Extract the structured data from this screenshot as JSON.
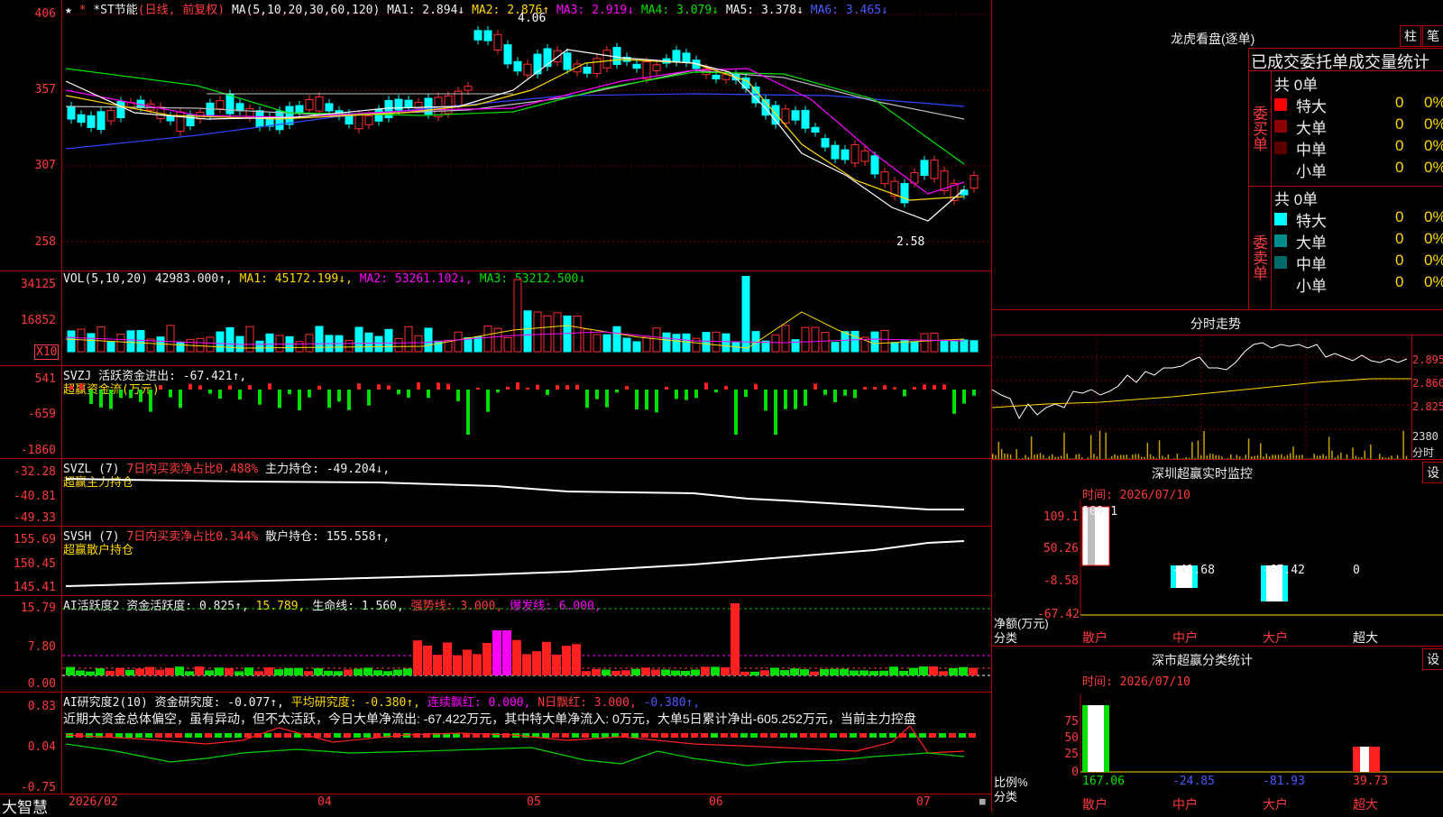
{
  "header": {
    "star_icon": "★",
    "stock_name": "*ST节能",
    "chart_mode": "(日线, 前复权)",
    "ma_label": "MA(5,10,20,30,60,120)",
    "ma1": "MA1: 2.894↓",
    "ma2": "MA2: 2.876↑",
    "ma3": "MA3: 2.919↓",
    "ma4": "MA4: 3.079↓",
    "ma5": "MA5: 3.378↓",
    "ma6": "MA6: 3.465↓"
  },
  "price_axis": [
    "406",
    "357",
    "307",
    "258"
  ],
  "price_annotations": {
    "high": "4.06",
    "low": "2.58"
  },
  "volume": {
    "label": "VOL(5,10,20)",
    "value": "42983.000↑,",
    "ma1": "MA1: 45172.199↓,",
    "ma2": "MA2: 53261.102↓,",
    "ma3": "MA3: 53212.500↓",
    "axis": [
      "34125",
      "16852"
    ],
    "unit": "X10"
  },
  "svzj": {
    "label": "SVZJ",
    "value": "活跃资金进出: -67.421↑,",
    "subtitle": "超赢资金流(万元)",
    "axis": [
      "541",
      "-659",
      "-1860"
    ]
  },
  "svzl": {
    "label": "SVZL (7)",
    "ratio": "7日内买卖净占比0.488%",
    "value": "主力持仓: -49.204↓,",
    "subtitle": "超赢主力持仓",
    "axis": [
      "-32.28",
      "-40.81",
      "-49.33"
    ]
  },
  "svsh": {
    "label": "SVSH (7)",
    "ratio": "7日内买卖净占比0.344%",
    "value": "散户持仓: 155.558↑,",
    "subtitle": "超赢散户持仓",
    "axis": [
      "155.69",
      "150.45",
      "145.41"
    ]
  },
  "ai_active": {
    "label": "AI活跃度2",
    "value": "资金活跃度: 0.825↑,",
    "v2": "15.789,",
    "life": "生命线: 1.560,",
    "strong": "强势线: 3.000,",
    "burst": "爆发线: 6.000,",
    "axis": [
      "15.79",
      "7.80",
      "0.00"
    ]
  },
  "ai_research": {
    "label": "AI研究度2(10)",
    "value": "资金研究度: -0.077↑,",
    "avg": "平均研究度: -0.380↑,",
    "cont": "连续飘红: 0.000,",
    "nday": "N日飘红: 3.000,",
    "last": "-0.380↑,",
    "commentary": "近期大资金总体偏空，虽有异动，但不太活跃，今日大单净流出: -67.422万元，其中特大单净流入: 0万元，大单5日累计净出-605.252万元，当前主力控盘",
    "axis": [
      "0.83",
      "0.04",
      "-0.75"
    ]
  },
  "date_axis": [
    "2026/02",
    "04",
    "05",
    "06",
    "07"
  ],
  "brand": "大智慧",
  "right_panel": {
    "title": "龙虎看盘(逐单)",
    "btn_bar": "柱",
    "btn_pen": "笔",
    "tabs": "已成交委托单成交量统计",
    "buy": {
      "side_label": "委买单",
      "total": "共 0单",
      "rows": [
        {
          "name": "特大",
          "count": "0",
          "pct": "0%",
          "color": "#ff0000"
        },
        {
          "name": "大单",
          "count": "0",
          "pct": "0%",
          "color": "#8b0000"
        },
        {
          "name": "中单",
          "count": "0",
          "pct": "0%",
          "color": "#5a0000"
        },
        {
          "name": "小单",
          "count": "0",
          "pct": "0%",
          "color": "#000000"
        }
      ]
    },
    "sell": {
      "side_label": "委卖单",
      "total": "共 0单",
      "rows": [
        {
          "name": "特大",
          "count": "0",
          "pct": "0%",
          "color": "#00ffff"
        },
        {
          "name": "大单",
          "count": "0",
          "pct": "0%",
          "color": "#008b8b"
        },
        {
          "name": "中单",
          "count": "0",
          "pct": "0%",
          "color": "#006a6a"
        },
        {
          "name": "小单",
          "count": "0",
          "pct": "0%",
          "color": "#000000"
        }
      ]
    },
    "intraday": {
      "title": "分时走势",
      "axis": [
        "2.895",
        "2.860",
        "2.825"
      ],
      "vol_label": "2380",
      "vol_unit": "分时"
    },
    "realtime": {
      "title": "深圳超赢实时监控",
      "settings": "设",
      "time": "时间: 2026/07/10",
      "axis": [
        "109.1",
        "50.26",
        "-8.58",
        "-67.42"
      ],
      "bar_values": [
        "109.1",
        "-41.68",
        "-67.42",
        "0"
      ],
      "ylabel": "净额(万元)",
      "xlabel": "分类",
      "categories": [
        "散户",
        "中户",
        "大户",
        "超大"
      ]
    },
    "classify": {
      "title": "深市超赢分类统计",
      "settings": "设",
      "time": "时间: 2026/07/10",
      "axis": [
        "75",
        "50",
        "25",
        "0"
      ],
      "bar_values": [
        "167.06",
        "-24.85",
        "-81.93",
        "39.73"
      ],
      "ylabel": "比例%",
      "xlabel": "分类",
      "categories": [
        "散户",
        "中户",
        "大户",
        "超大"
      ]
    }
  }
}
